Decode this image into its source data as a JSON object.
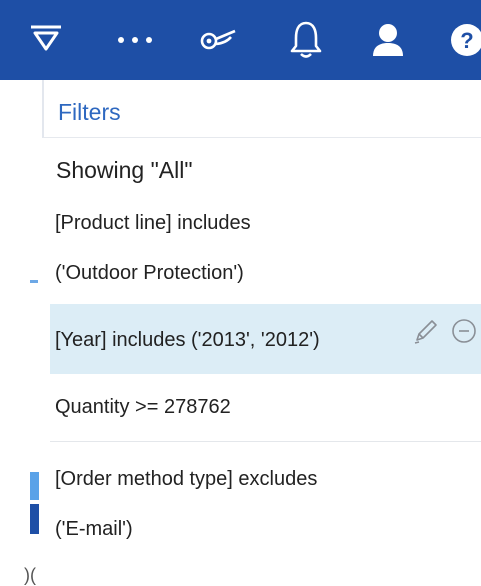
{
  "toolbar": {
    "icons": [
      "filter-icon",
      "more-options-icon",
      "glasses-icon",
      "bell-icon",
      "user-icon",
      "help-icon"
    ],
    "help_glyph": "?",
    "background": "#1e4fa6"
  },
  "left_strip": {
    "partial_text": ")("
  },
  "panel": {
    "title": "Filters",
    "showing": "Showing \"All\"",
    "filters": [
      {
        "lines": [
          "[Product line] includes",
          "('Outdoor Protection')"
        ],
        "selected": false
      },
      {
        "lines": [
          "[Year] includes ('2013', '2012')"
        ],
        "selected": true,
        "actions": [
          "edit-icon",
          "remove-icon"
        ]
      },
      {
        "lines": [
          "Quantity  >= 278762"
        ],
        "selected": false
      },
      {
        "lines": [
          "[Order method type] excludes",
          "('E-mail')"
        ],
        "selected": false
      }
    ]
  },
  "colors": {
    "accent": "#2e68c0",
    "selected_bg": "#dcedf6",
    "toolbar_bg": "#1e4fa6"
  }
}
